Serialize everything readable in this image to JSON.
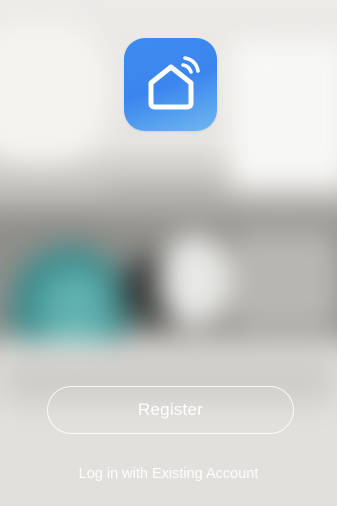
{
  "app": {
    "logo_icon": "smart-home-icon",
    "logo_gradient": [
      "#3d8bf0",
      "#6fb8f0"
    ]
  },
  "actions": {
    "register_label": "Register",
    "login_label": "Log in with Existing Account"
  },
  "colors": {
    "button_text": "#ffffff",
    "button_border": "#ffffff"
  }
}
